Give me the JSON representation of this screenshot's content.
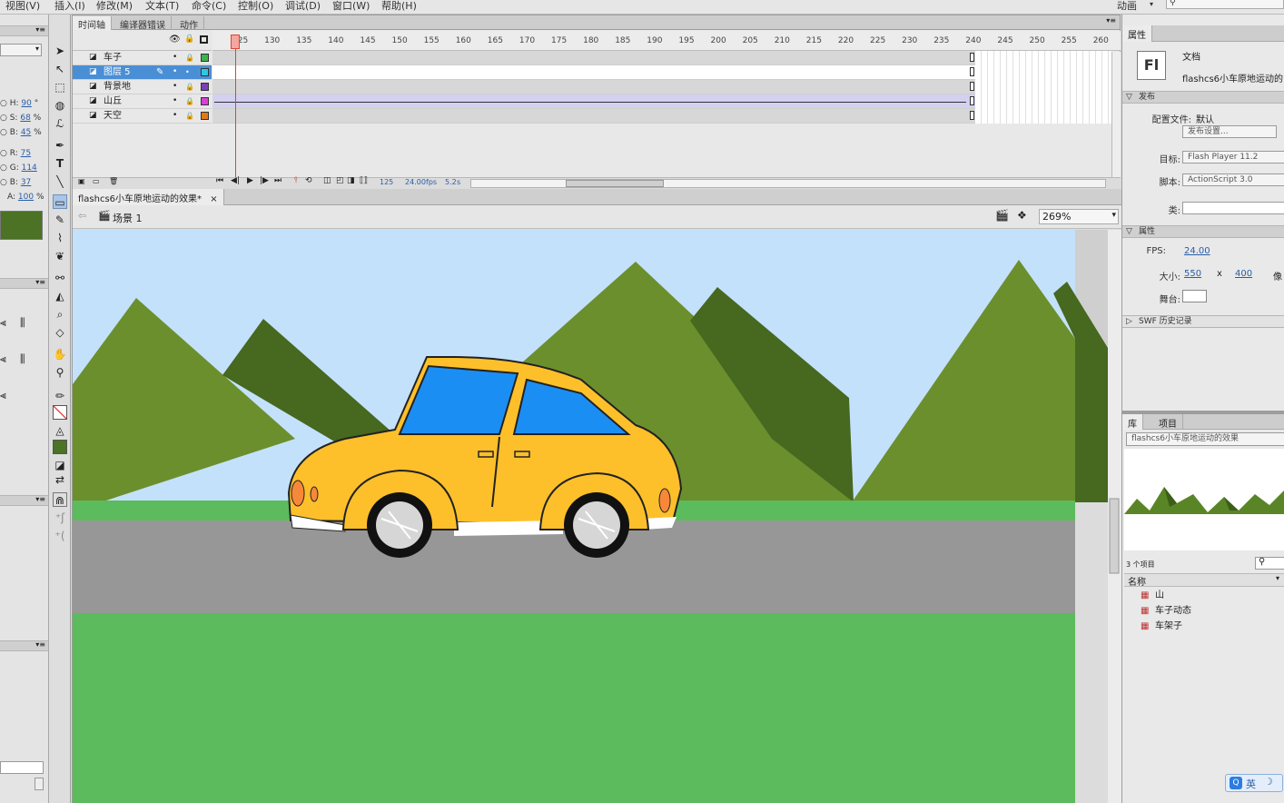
{
  "menu": [
    "视图(V)",
    "插入(I)",
    "修改(M)",
    "文本(T)",
    "命令(C)",
    "控制(O)",
    "调试(D)",
    "窗口(W)",
    "帮助(H)"
  ],
  "workspace": "动画",
  "left_panel": {
    "h": "90",
    "s": "68",
    "b": "45",
    "r": "75",
    "g": "114",
    "b2": "37",
    "a": "100",
    "labels": {
      "h": "H:",
      "s": "S:",
      "b": "B:",
      "r": "R:",
      "g": "G:",
      "b2": "B:",
      "a": "A:",
      "deg": "°",
      "pct": "%"
    },
    "swatch_color": "#4b7225"
  },
  "timeline": {
    "tabs": [
      "时间轴",
      "编译器错误",
      "动作"
    ],
    "ruler": [
      "125",
      "130",
      "135",
      "140",
      "145",
      "150",
      "155",
      "160",
      "165",
      "170",
      "175",
      "180",
      "185",
      "190",
      "195",
      "200",
      "205",
      "210",
      "215",
      "220",
      "225",
      "230",
      "235",
      "240",
      "245",
      "250",
      "255",
      "260"
    ],
    "layers": [
      {
        "name": "车子",
        "color": "#3cb44b",
        "selected": false
      },
      {
        "name": "图层 5",
        "color": "#2ec9e0",
        "selected": true
      },
      {
        "name": "背景地",
        "color": "#7b3fb8",
        "selected": false
      },
      {
        "name": "山丘",
        "color": "#d93fd9",
        "selected": false
      },
      {
        "name": "天空",
        "color": "#e07a1a",
        "selected": false
      }
    ],
    "current_frame": "125",
    "fps": "24.00",
    "fps_unit": "fps",
    "time": "5.2",
    "time_unit": "s"
  },
  "document": {
    "tab": "flashcs6小车原地运动的效果*",
    "close": "×",
    "scene": "场景 1",
    "zoom": "269%"
  },
  "properties": {
    "tab": "属性",
    "doc_type": "文档",
    "doc_name": "flashcs6小车原地运动的",
    "logo": "Fl",
    "publish_section": "发布",
    "profile_label": "配置文件:",
    "profile_value": "默认",
    "publish_settings": "发布设置...",
    "target_label": "目标:",
    "target": "Flash Player 11.2",
    "script_label": "脚本:",
    "script": "ActionScript 3.0",
    "class_label": "类:",
    "props_section": "属性",
    "fps_label": "FPS:",
    "fps": "24.00",
    "size_label": "大小:",
    "width": "550",
    "x": "x",
    "height": "400",
    "unit": "像",
    "stage_label": "舞台:",
    "swf_history": "SWF 历史记录"
  },
  "library": {
    "tabs": [
      "库",
      "项目"
    ],
    "doc": "flashcs6小车原地运动的效果",
    "count": "3 个项目",
    "column": "名称",
    "items": [
      "山",
      "车子动态",
      "车架子"
    ]
  },
  "ime": {
    "lang": "英"
  }
}
